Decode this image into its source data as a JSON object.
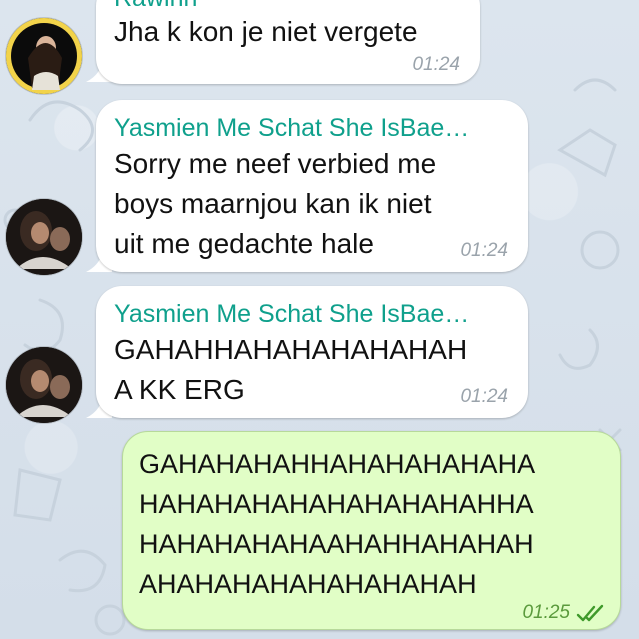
{
  "messages": [
    {
      "direction": "incoming",
      "sender": "Rawinn",
      "text_lines": [
        "Jha k kon je niet vergete"
      ],
      "time": "01:24"
    },
    {
      "direction": "incoming",
      "sender": "Yasmien Me Schat She IsBae…",
      "text_lines": [
        "Sorry me neef verbied me",
        "boys maarnjou kan ik niet",
        "uit me gedachte hale"
      ],
      "time": "01:24"
    },
    {
      "direction": "incoming",
      "sender": "Yasmien Me Schat She IsBae…",
      "text_lines": [
        "GAHAHHAHAHAHAHAHAH",
        "A KK ERG"
      ],
      "time": "01:24"
    },
    {
      "direction": "outgoing",
      "text_lines": [
        "GAHAHAHAHHAHAHAHAHAHA",
        "HAHAHAHAHAHAHAHAHAHHA",
        "HAHAHAHAHAAHAHHAHAHAH",
        "AHAHAHAHAHAHAHAHAH"
      ],
      "time": "01:25",
      "status_icon": "double-check-icon"
    }
  ],
  "colors": {
    "sender_name": "#0fa08c",
    "outgoing_bubble": "#e1fec6",
    "incoming_bubble": "#ffffff",
    "read_ticks": "#3f9a2b"
  }
}
